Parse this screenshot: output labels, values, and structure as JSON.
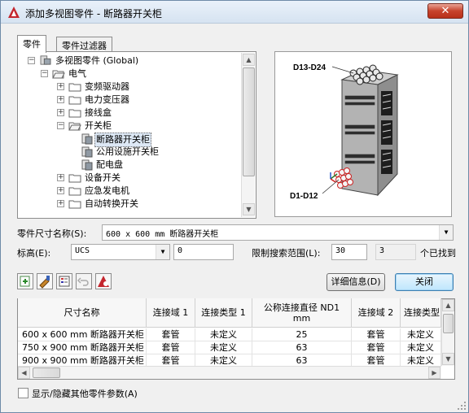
{
  "window": {
    "title": "添加多视图零件 - 断路器开关柜",
    "close_label": "✕"
  },
  "tabs": [
    {
      "label": "零件"
    },
    {
      "label": "零件过滤器"
    }
  ],
  "tree": {
    "root": "多视图零件 (Global)",
    "items": [
      {
        "label": "电气"
      },
      {
        "label": "变频驱动器"
      },
      {
        "label": "电力变压器"
      },
      {
        "label": "接线盒"
      },
      {
        "label": "开关柜"
      },
      {
        "label": "断路器开关柜"
      },
      {
        "label": "公用设施开关柜"
      },
      {
        "label": "配电盘"
      },
      {
        "label": "设备开关"
      },
      {
        "label": "应急发电机"
      },
      {
        "label": "自动转换开关"
      }
    ]
  },
  "preview": {
    "label_top": "D13-D24",
    "label_bottom": "D1-D12"
  },
  "size_field": {
    "label": "零件尺寸名称(S):",
    "value": "600 x 600 mm 断路器开关柜"
  },
  "elevation": {
    "label": "标高(E):",
    "ucs_value": "UCS",
    "offset_value": "0"
  },
  "search": {
    "label": "限制搜索范围(L):",
    "limit_value": "30",
    "found_value": "3",
    "found_label": "个已找到"
  },
  "buttons": {
    "details": "详细信息(D)",
    "close": "关闭"
  },
  "grid": {
    "headers": [
      "尺寸名称",
      "连接域 1",
      "连接类型 1",
      "公称连接直径 ND1 mm",
      "连接域 2",
      "连接类型"
    ],
    "rows": [
      [
        "600 x 600 mm 断路器开关柜",
        "套管",
        "未定义",
        "25",
        "套管",
        "未定义"
      ],
      [
        "750 x 900 mm 断路器开关柜",
        "套管",
        "未定义",
        "63",
        "套管",
        "未定义"
      ],
      [
        "900 x 900 mm 断路器开关柜",
        "套管",
        "未定义",
        "63",
        "套管",
        "未定义"
      ]
    ]
  },
  "toggle": {
    "label": "显示/隐藏其他零件参数(A)"
  }
}
